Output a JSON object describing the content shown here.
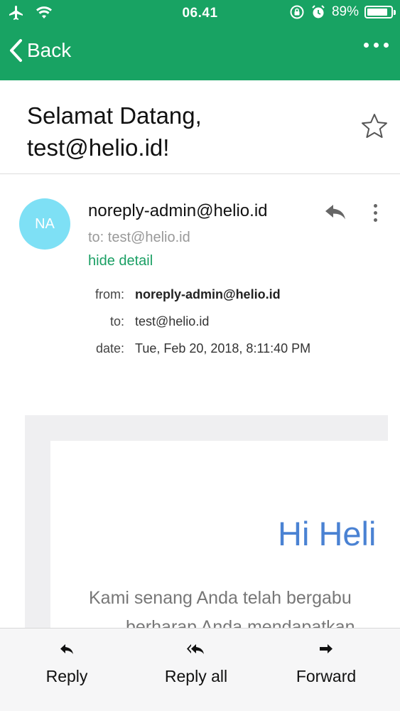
{
  "status_bar": {
    "time": "06.41",
    "battery_percent": "89%",
    "battery_level": 0.89
  },
  "nav": {
    "back_label": "Back"
  },
  "email": {
    "subject": "Selamat Datang, test@helio.id!",
    "avatar_initials": "NA",
    "sender": "noreply-admin@helio.id",
    "to_line": "to: test@helio.id",
    "hide_detail_label": "hide detail",
    "details": {
      "from_label": "from:",
      "from_value": "noreply-admin@helio.id",
      "to_label": "to:",
      "to_value": "test@helio.id",
      "date_label": "date:",
      "date_value": "Tue, Feb 20, 2018, 8:11:40 PM"
    },
    "body": {
      "greeting": "Hi Heli",
      "line1": "Kami senang Anda telah bergabu",
      "line2": "berharap Anda mendapatkan"
    }
  },
  "toolbar": {
    "reply_label": "Reply",
    "reply_all_label": "Reply all",
    "forward_label": "Forward"
  },
  "colors": {
    "header_green": "#18a363",
    "accent_green": "#1a9f64",
    "avatar_cyan": "#7ee0f5",
    "greeting_blue": "#4a82d3"
  }
}
